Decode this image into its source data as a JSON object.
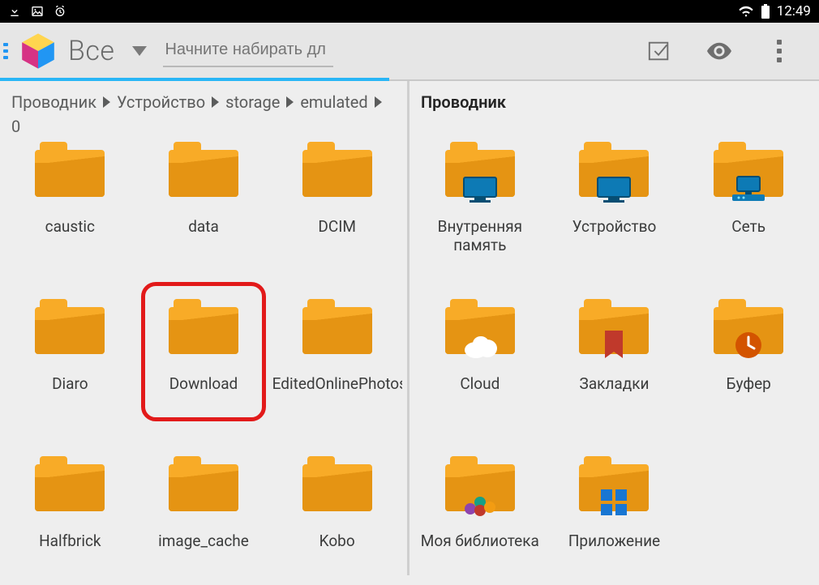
{
  "statusbar": {
    "time": "12:49"
  },
  "toolbar": {
    "spinner_label": "Все",
    "search_placeholder": "Начните набирать дл"
  },
  "left": {
    "breadcrumbs": [
      "Проводник",
      "Устройство",
      "storage",
      "emulated",
      "0"
    ],
    "folders": [
      {
        "label": "caustic"
      },
      {
        "label": "data"
      },
      {
        "label": "DCIM"
      },
      {
        "label": "Diaro"
      },
      {
        "label": "Download",
        "highlighted": true
      },
      {
        "label": "EditedOnlinePhotos"
      },
      {
        "label": "Halfbrick"
      },
      {
        "label": "image_cache"
      },
      {
        "label": "Kobo"
      }
    ]
  },
  "right": {
    "title": "Проводник",
    "items": [
      {
        "label": "Внутренняя память",
        "icon": "internal"
      },
      {
        "label": "Устройство",
        "icon": "device"
      },
      {
        "label": "Сеть",
        "icon": "network"
      },
      {
        "label": "Cloud",
        "icon": "cloud"
      },
      {
        "label": "Закладки",
        "icon": "bookmark"
      },
      {
        "label": "Буфер",
        "icon": "clock"
      },
      {
        "label": "Моя библиотека",
        "icon": "library"
      },
      {
        "label": "Приложение",
        "icon": "apps"
      }
    ]
  }
}
